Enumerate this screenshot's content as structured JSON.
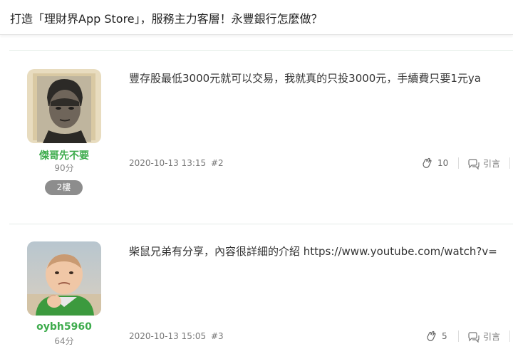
{
  "page": {
    "title": "打造「理財界App Store」，服務主力客層！永豐銀行怎麼做？"
  },
  "posts": [
    {
      "username": "傑哥先不要",
      "points": "90分",
      "floor": "2樓",
      "content": "豐存股最低3000元就可以交易，我就真的只投3000元，手續費只要1元ya",
      "datetime": "2020-10-13 13:15",
      "post_number": "#2",
      "claps": "10",
      "quote_label": "引言",
      "avatar_icon": "portrait-photo-icon"
    },
    {
      "username": "oybh5960",
      "points": "64分",
      "content": "柴鼠兄弟有分享，內容很詳細的介紹 https://www.youtube.com/watch?v=",
      "datetime": "2020-10-13 15:05",
      "post_number": "#3",
      "claps": "5",
      "quote_label": "引言",
      "avatar_icon": "baby-photo-icon"
    }
  ],
  "colors": {
    "username": "#3cab4b",
    "badge": "#8d8d8d",
    "divider": "#e3ece6"
  }
}
